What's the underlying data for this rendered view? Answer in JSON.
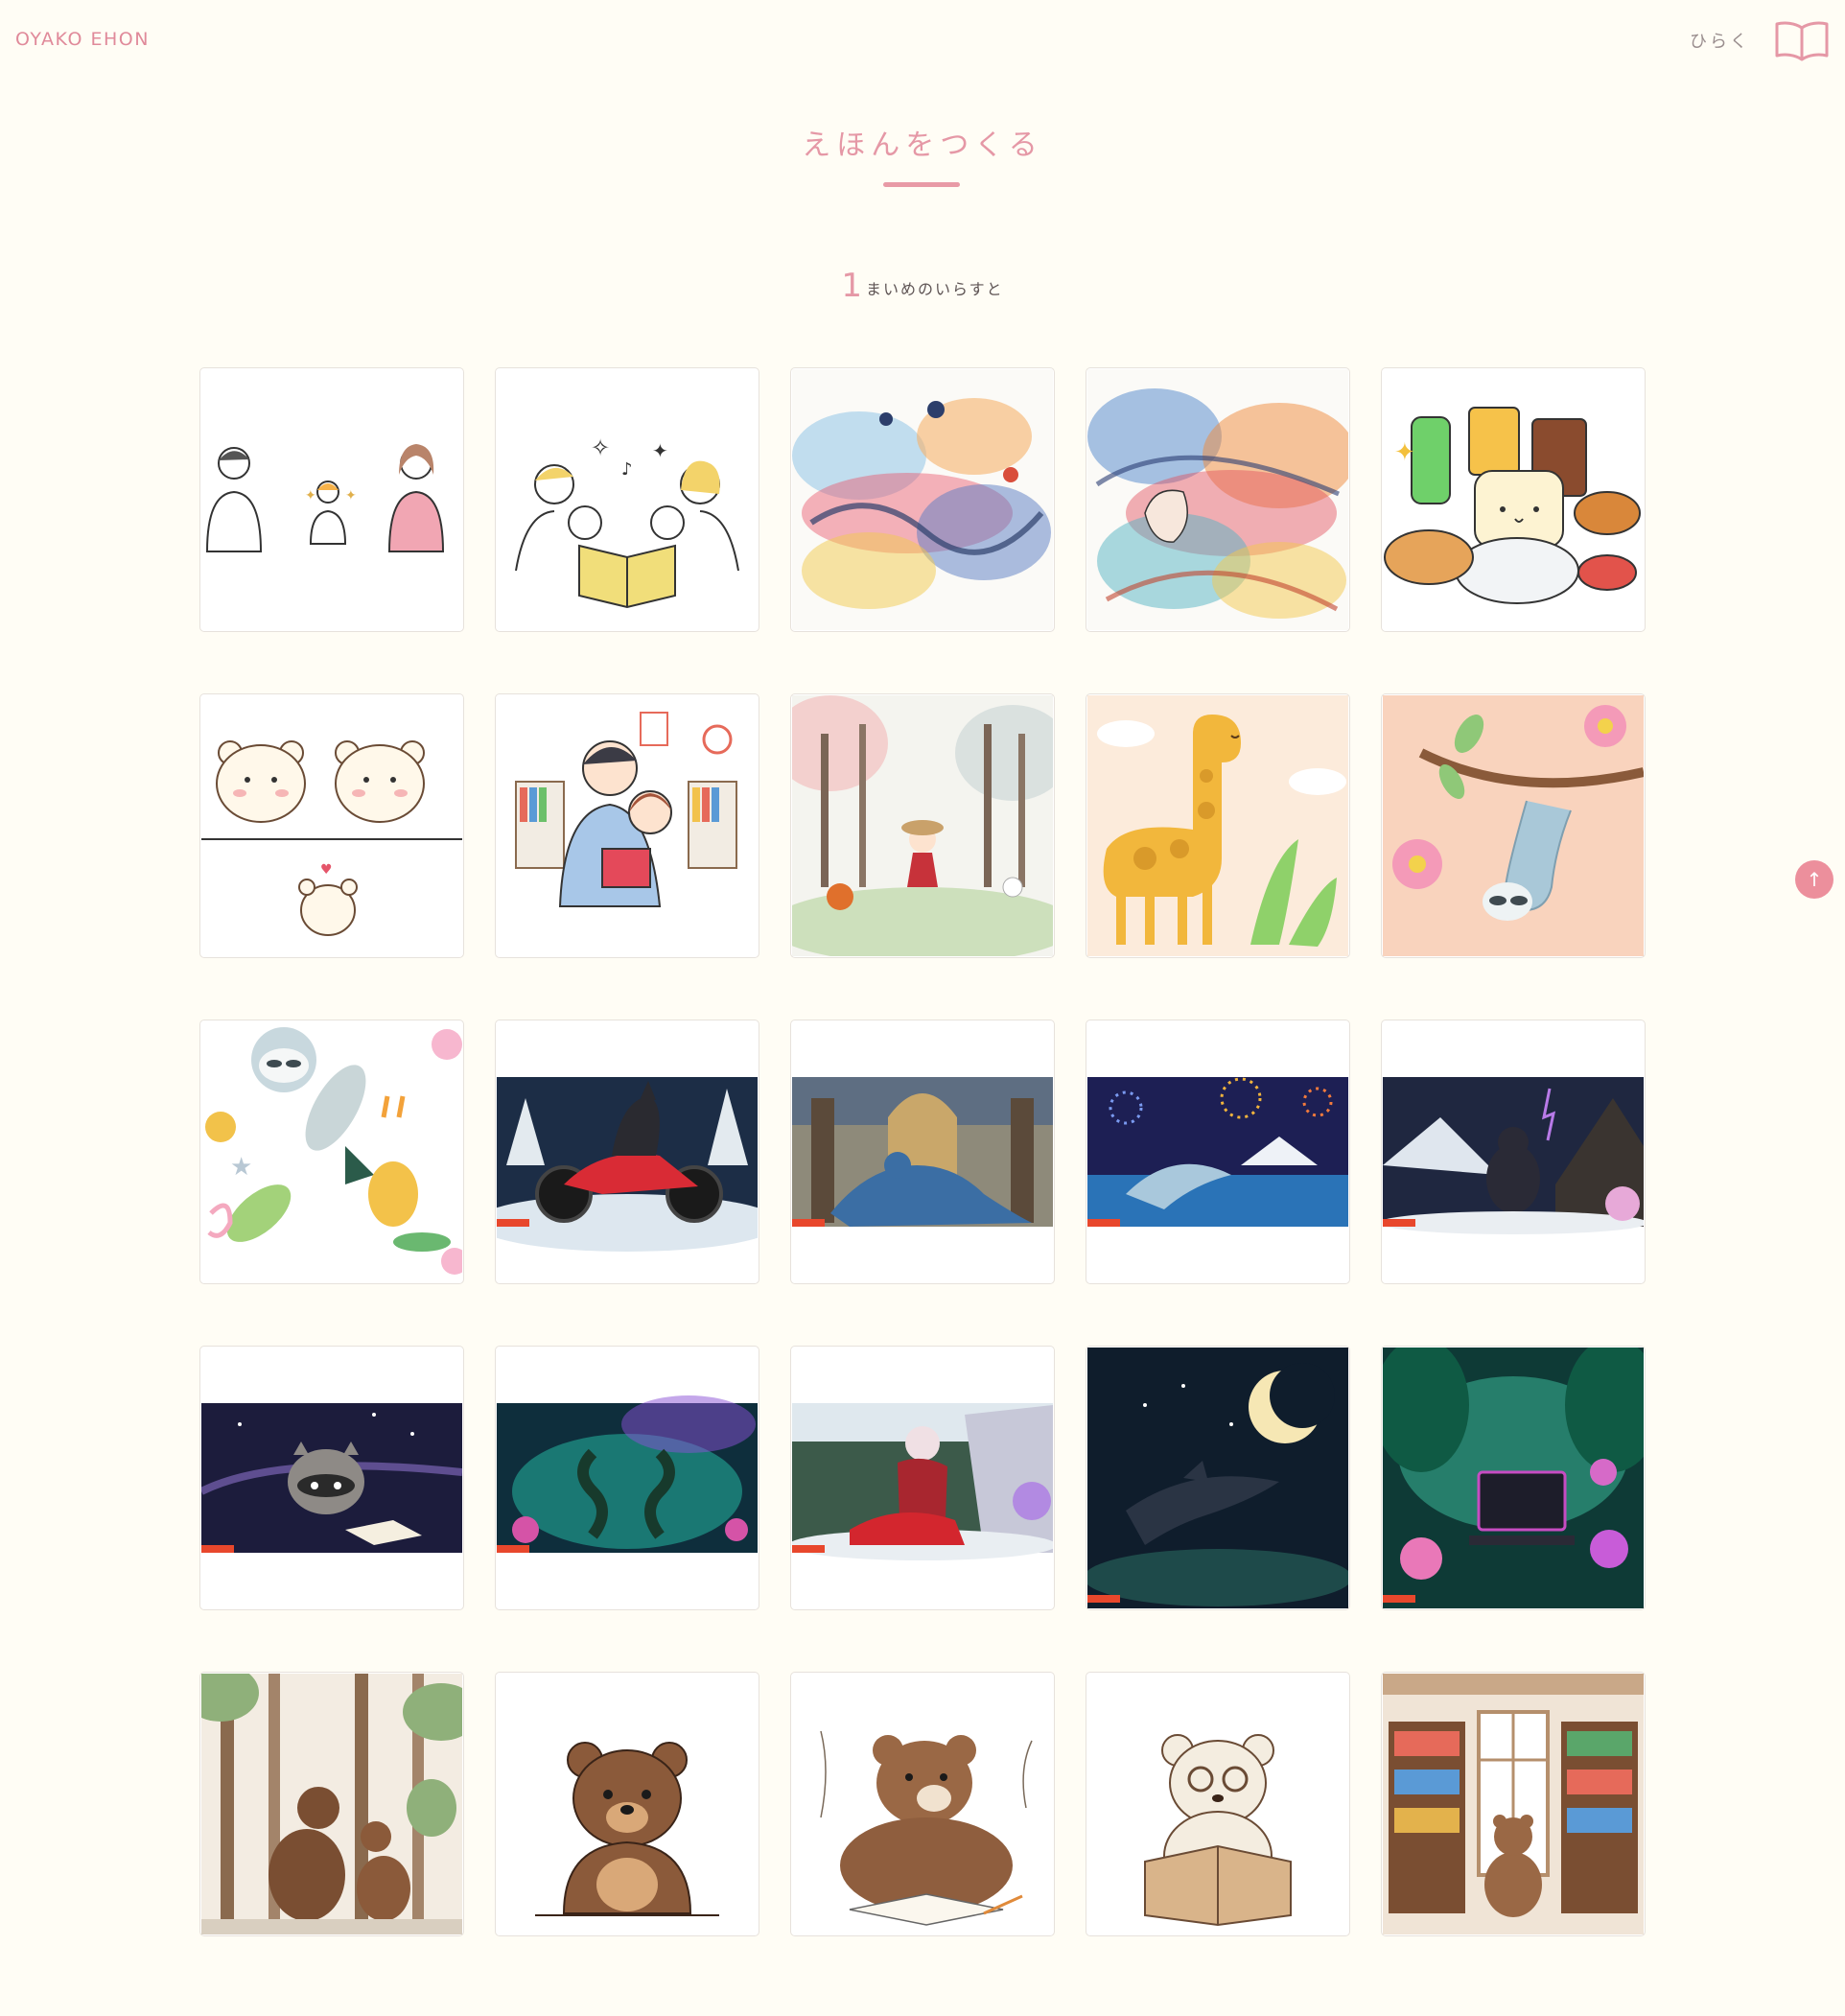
{
  "header": {
    "logo": "OYAKO EHON",
    "open_label": "ひらく",
    "book_icon": "open-book-icon"
  },
  "page": {
    "title": "えほんをつくる",
    "step_number": "1",
    "step_text": "まいめのいらすと"
  },
  "colors": {
    "accent": "#e598a6",
    "background": "#fffdf5",
    "scroll_button": "#ec8f9c"
  },
  "scroll_top": {
    "icon": "arrow-up-icon",
    "symbol": "↑"
  },
  "illustrations": [
    {
      "subject": "parents-and-child-line-art"
    },
    {
      "subject": "family-reading-book-line-art"
    },
    {
      "subject": "watercolor-abstract-swirls"
    },
    {
      "subject": "watercolor-abstract-face"
    },
    {
      "subject": "kawaii-food-and-drinks"
    },
    {
      "subject": "three-cute-bears"
    },
    {
      "subject": "father-reading-to-child"
    },
    {
      "subject": "girl-in-watercolor-forest"
    },
    {
      "subject": "giraffe"
    },
    {
      "subject": "sloth-on-branch"
    },
    {
      "subject": "animal-pattern"
    },
    {
      "subject": "wolf-on-motorcycle"
    },
    {
      "subject": "dinosaur-in-palace"
    },
    {
      "subject": "dolphin-and-fireworks"
    },
    {
      "subject": "gorilla-on-mountain"
    },
    {
      "subject": "raccoon-reading-under-stars"
    },
    {
      "subject": "seahorses-in-glowing-sea"
    },
    {
      "subject": "lizard-on-motorcycle"
    },
    {
      "subject": "dolphin-and-crescent-moon"
    },
    {
      "subject": "computer-in-jungle"
    },
    {
      "subject": "bears-in-forest"
    },
    {
      "subject": "brown-bear-sitting"
    },
    {
      "subject": "bear-with-book-sketch"
    },
    {
      "subject": "bear-with-glasses-reading"
    },
    {
      "subject": "bear-in-library"
    }
  ]
}
